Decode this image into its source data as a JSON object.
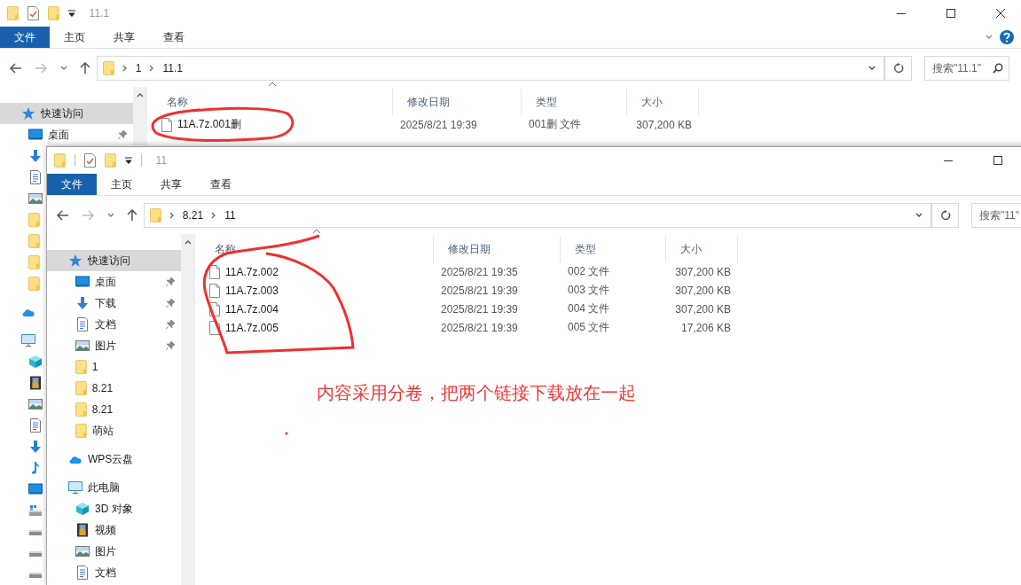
{
  "windows": [
    {
      "title": "11.1",
      "controls": [
        {
          "kind": "minimize"
        },
        {
          "kind": "maximize"
        },
        {
          "kind": "close"
        }
      ],
      "ribbon_controls": [
        {
          "kind": "expand"
        },
        {
          "kind": "help"
        }
      ],
      "ribbon_tabs": [
        {
          "label": "文件",
          "selected": true
        },
        {
          "label": "主页",
          "selected": false
        },
        {
          "label": "共享",
          "selected": false
        },
        {
          "label": "查看",
          "selected": false
        }
      ],
      "breadcrumb": [
        "1",
        "11.1"
      ],
      "search": {
        "placeholder": "搜索\"11.1\""
      },
      "columns": [
        "名称",
        "修改日期",
        "类型",
        "大小"
      ],
      "files": [
        {
          "name": "11A.7z.001删",
          "modified": "2025/8/21 19:39",
          "type": "001删 文件",
          "size": "307,200 KB"
        }
      ],
      "sidebar": [
        {
          "kind": "star",
          "label": "快速访问",
          "selected": true,
          "children": [
            {
              "kind": "desktop",
              "label": "桌面",
              "pinned": true,
              "selected": false
            },
            {
              "kind": "download",
              "selected": false
            },
            {
              "kind": "document",
              "selected": false
            },
            {
              "kind": "picture",
              "selected": false
            },
            {
              "kind": "folder",
              "selected": false
            },
            {
              "kind": "folder",
              "selected": false
            },
            {
              "kind": "folder",
              "selected": false
            },
            {
              "kind": "folder",
              "selected": false
            }
          ]
        },
        {
          "kind": "cloud",
          "selected": false
        },
        {
          "kind": "pc",
          "selected": false,
          "children": [
            {
              "kind": "cube",
              "selected": false
            },
            {
              "kind": "video",
              "selected": false
            },
            {
              "kind": "picture",
              "selected": false
            },
            {
              "kind": "document",
              "selected": false
            },
            {
              "kind": "download",
              "selected": false
            },
            {
              "kind": "music",
              "selected": false
            },
            {
              "kind": "desktop",
              "selected": false
            },
            {
              "kind": "system-drive",
              "selected": false
            },
            {
              "kind": "drive",
              "selected": false
            },
            {
              "kind": "drive",
              "selected": false
            },
            {
              "kind": "drive",
              "selected": false
            }
          ]
        }
      ]
    },
    {
      "title": "11",
      "controls": [
        {
          "kind": "minimize"
        },
        {
          "kind": "maximize"
        }
      ],
      "ribbon_tabs": [
        {
          "label": "文件",
          "selected": true
        },
        {
          "label": "主页",
          "selected": false
        },
        {
          "label": "共享",
          "selected": false
        },
        {
          "label": "查看",
          "selected": false
        }
      ],
      "breadcrumb": [
        "8.21",
        "11"
      ],
      "search": {
        "placeholder": "搜索\"11\""
      },
      "columns": [
        "名称",
        "修改日期",
        "类型",
        "大小"
      ],
      "files": [
        {
          "name": "11A.7z.002",
          "modified": "2025/8/21 19:35",
          "type": "002 文件",
          "size": "307,200 KB"
        },
        {
          "name": "11A.7z.003",
          "modified": "2025/8/21 19:39",
          "type": "003 文件",
          "size": "307,200 KB"
        },
        {
          "name": "11A.7z.004",
          "modified": "2025/8/21 19:39",
          "type": "004 文件",
          "size": "307,200 KB"
        },
        {
          "name": "11A.7z.005",
          "modified": "2025/8/21 19:39",
          "type": "005 文件",
          "size": "17,206 KB"
        }
      ],
      "sidebar": [
        {
          "kind": "star",
          "label": "快速访问",
          "selected": true,
          "children": [
            {
              "kind": "desktop",
              "label": "桌面",
              "pinned": true,
              "selected": false
            },
            {
              "kind": "download",
              "label": "下载",
              "pinned": true,
              "selected": false
            },
            {
              "kind": "document",
              "label": "文档",
              "pinned": true,
              "selected": false
            },
            {
              "kind": "picture",
              "label": "图片",
              "pinned": true,
              "selected": false
            },
            {
              "kind": "folder",
              "label": "1",
              "pinned": false,
              "selected": false
            },
            {
              "kind": "folder",
              "label": "8.21",
              "pinned": false,
              "selected": false
            },
            {
              "kind": "folder",
              "label": "8.21",
              "pinned": false,
              "selected": false
            },
            {
              "kind": "folder",
              "label": "萌站",
              "pinned": false,
              "selected": false
            }
          ]
        },
        {
          "kind": "cloud",
          "label": "WPS云盘",
          "selected": false
        },
        {
          "kind": "pc",
          "label": "此电脑",
          "selected": false,
          "children": [
            {
              "kind": "cube",
              "label": "3D 对象",
              "selected": false
            },
            {
              "kind": "video",
              "label": "视频",
              "selected": false
            },
            {
              "kind": "picture",
              "label": "图片",
              "selected": false
            },
            {
              "kind": "document",
              "label": "文档",
              "selected": false
            }
          ]
        }
      ]
    }
  ],
  "annotation": {
    "note": "内容采用分卷，把两个链接下载放在一起"
  }
}
